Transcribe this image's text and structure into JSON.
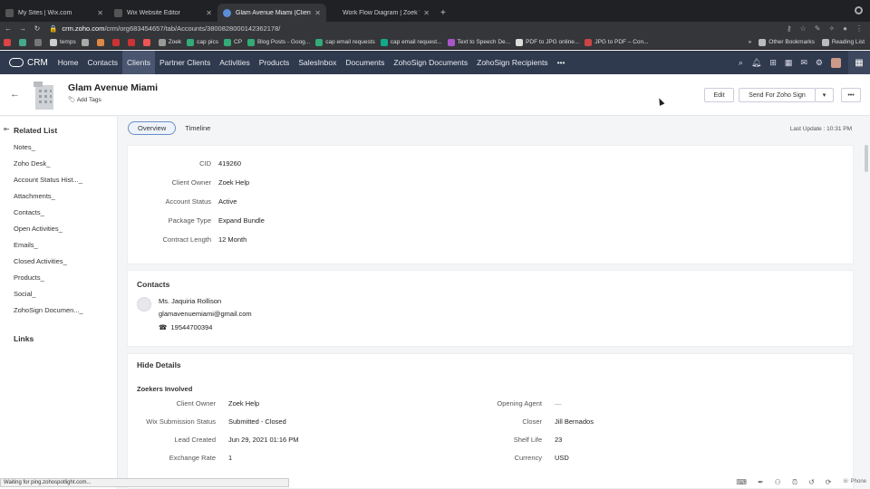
{
  "browser": {
    "tabs": [
      {
        "title": "My Sites | Wix.com"
      },
      {
        "title": "Wix Website Editor"
      },
      {
        "title": "Glam Avenue Miami (Client) - "
      },
      {
        "title": "Work Flow Diagram | Zoek Wo"
      }
    ],
    "url_domain": "crm.zoho.com",
    "url_path": "/crm/org683454657/tab/Accounts/3800828000142362178/",
    "bookmarks": [
      "temps",
      "Zoek",
      "cap pics",
      "CP",
      "Blog Posts - Goog...",
      "cap email requests",
      "cap email request...",
      "Text to Speech De...",
      "PDF to JPG online...",
      "JPG to PDF – Con..."
    ],
    "bookmarks_right": [
      "Other Bookmarks",
      "Reading List"
    ]
  },
  "crm": {
    "brand": "CRM",
    "nav": [
      "Home",
      "Contacts",
      "Clients",
      "Partner Clients",
      "Activities",
      "Products",
      "SalesInbox",
      "Documents",
      "ZohoSign Documents",
      "ZohoSign Recipients"
    ],
    "more": "•••"
  },
  "record": {
    "title": "Glam Avenue Miami",
    "add_tags": "Add Tags",
    "edit": "Edit",
    "send_sign": "Send For Zoho Sign",
    "caret": "▾",
    "more": "•••"
  },
  "sidebar": {
    "related_heading": "Related List",
    "items": [
      "Notes_",
      "Zoho Desk_",
      "Account Status Hist..._",
      "Attachments_",
      "Contacts_",
      "Open Activities_",
      "Emails_",
      "Closed Activities_",
      "Products_",
      "Social_",
      "ZohoSign Documen..._"
    ],
    "links_heading": "Links"
  },
  "main": {
    "tabs": [
      "Overview",
      "Timeline"
    ],
    "last_update": "Last Update : 10:31 PM",
    "summary": [
      {
        "k": "CID",
        "v": "419260"
      },
      {
        "k": "Client Owner",
        "v": "Zoek Help"
      },
      {
        "k": "Account Status",
        "v": "Active"
      },
      {
        "k": "Package Type",
        "v": "Expand Bundle"
      },
      {
        "k": "Contract Length",
        "v": "12 Month"
      }
    ],
    "contacts": {
      "heading": "Contacts",
      "name": "Ms. Jaquiria Rollison",
      "email": "glamavenuemiami@gmail.com",
      "phone": "19544700394"
    },
    "details": {
      "heading": "Hide Details",
      "section": "Zoekers Involved",
      "left": [
        {
          "k": "Client Owner",
          "v": "Zoek Help"
        },
        {
          "k": "Wix Submission Status",
          "v": "Submitted - Closed"
        },
        {
          "k": "Lead Created",
          "v": "Jun 29, 2021 01:16 PM"
        },
        {
          "k": "Exchange Rate",
          "v": "1"
        }
      ],
      "right": [
        {
          "k": "Opening Agent",
          "v": "—"
        },
        {
          "k": "Closer",
          "v": "Jill Bernados"
        },
        {
          "k": "Shelf Life",
          "v": "23"
        },
        {
          "k": "Currency",
          "v": "USD"
        }
      ]
    }
  },
  "status_bar": "Waiting for ping.zohospotlight.com...",
  "phone_label": "Phone"
}
